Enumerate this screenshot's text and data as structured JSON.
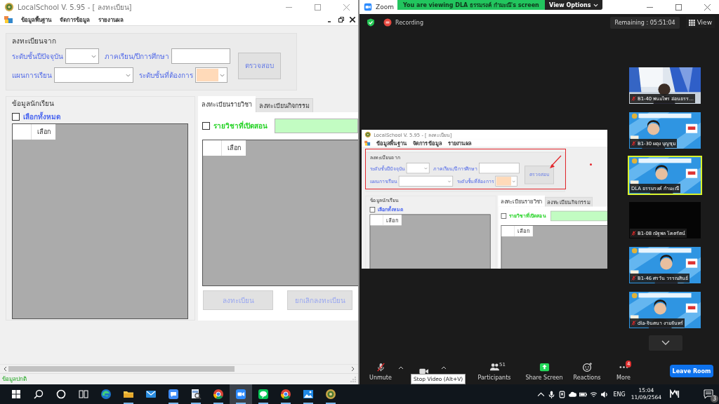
{
  "local_school": {
    "title": "LocalSchool V. 5.95 - [ ลงทะเบียน]",
    "menu": [
      "ข้อมูลพื้นฐาน",
      "จัดการข้อมูล",
      "รายงานผล"
    ],
    "register_from": {
      "title": "ลงทะเบียนจาก",
      "current_level_label": "ระดับชั้นปีปัจจุบัน",
      "term_label": "ภาคเรียน/ปีการศึกษา",
      "plan_label": "แผนการเรียน",
      "target_level_label": "ระดับชั้นที่ต้องการ",
      "check_button": "ตรวจสอบ"
    },
    "students": {
      "title": "ข้อมูลนักเรียน",
      "select_all": {
        "label": "เลือกทั้งหมด",
        "checked": false
      },
      "grid_header": "เลือก"
    },
    "tabs": [
      {
        "label": "ลงทะเบียนรายวิชา",
        "selected": true
      },
      {
        "label": "ลงทะเบียนกิจกรรม",
        "selected": false
      }
    ],
    "subjects": {
      "open_subjects": {
        "label": "รายวิชาที่เปิดสอน",
        "checked": false
      },
      "grid_header": "เลือก",
      "buttons": [
        {
          "label": "ลงทะเบียน",
          "disabled": true
        },
        {
          "label": "ยกเลิกลงทะเบียน",
          "disabled": true
        }
      ]
    },
    "status_bar": "ข้อมูลปกติ"
  },
  "zoom": {
    "title": "Zoom",
    "banner": "You are viewing DLA ธรรมรงค์ กำมะณี's screen",
    "view_options": "View Options",
    "recording": "Recording",
    "remaining": "Remaining : 05:51:04",
    "view": "View",
    "shared_screen": {
      "title": "LocalSchool V. 5.95 - [ ลงทะเบียน]",
      "menu": [
        "ข้อมูลพื้นฐาน",
        "จัดการข้อมูล",
        "รายงานผล"
      ],
      "register_from": {
        "title": "ลงทะเบียนจาก",
        "current_level_label": "ระดับชั้นปีปัจจุบัน",
        "term_label": "ภาคเรียน/ปีการศึกษา",
        "plan_label": "แผนการเรียน",
        "target_level_label": "ระดับชั้นที่ต้องการ",
        "check_button": "ตรวจสอบ"
      },
      "students": {
        "title": "ข้อมูลนักเรียน",
        "select_all": {
          "label": "เลือกทั้งหมด",
          "checked": false
        },
        "grid_header": "เลือก"
      },
      "tabs": [
        {
          "label": "ลงทะเบียนรายวิชา",
          "selected": true
        },
        {
          "label": "ลงทะเบียนกิจกรรม",
          "selected": false
        }
      ],
      "subjects": {
        "open_subjects": {
          "label": "รายวิชาที่เปิดสอน",
          "checked": false
        },
        "grid_header": "เลือก"
      }
    },
    "participants": [
      {
        "name": "B1-40 พนมไพร อ่อนธรร...",
        "muted": true,
        "video": true,
        "speaking": false
      },
      {
        "name": "B1-30 ผดุง บุญชุม",
        "muted": true,
        "video": true,
        "speaking": false
      },
      {
        "name": "DLA ธรรมรงค์ กำมะณี",
        "muted": false,
        "video": true,
        "speaking": true
      },
      {
        "name": "B1-08 ณัฐพล โคตรัตน์",
        "muted": true,
        "video": false,
        "speaking": false
      },
      {
        "name": "B1-46 ศรวัน วรรณสินธ์",
        "muted": true,
        "video": true,
        "speaking": false
      },
      {
        "name": "dla-จินตนา งามจันทร์",
        "muted": true,
        "video": true,
        "speaking": false
      }
    ],
    "toolbar": [
      {
        "kind": "mic",
        "label": "Unmute",
        "has_menu": true
      },
      {
        "kind": "video",
        "tooltip": "Stop Video (Alt+V)",
        "has_menu": true
      },
      {
        "kind": "participants",
        "label": "Participants",
        "count": "51",
        "has_menu": false
      },
      {
        "kind": "share",
        "label": "Share Screen",
        "has_menu": false
      },
      {
        "kind": "reactions",
        "label": "Reactions",
        "has_menu": false
      },
      {
        "kind": "more",
        "label": "More",
        "badge": "4",
        "has_menu": false
      }
    ],
    "leave_button": "Leave Room"
  },
  "taskbar": {
    "apps": [
      {
        "kind": "start",
        "active": false,
        "running": false
      },
      {
        "kind": "search",
        "active": false,
        "running": false
      },
      {
        "kind": "cortana",
        "active": false,
        "running": false
      },
      {
        "kind": "taskview",
        "active": false,
        "running": false
      },
      {
        "kind": "edge",
        "active": false,
        "running": false
      },
      {
        "kind": "folder",
        "active": false,
        "running": true
      },
      {
        "kind": "mail",
        "active": false,
        "running": false
      },
      {
        "kind": "chat",
        "active": false,
        "running": true
      },
      {
        "kind": "preview",
        "active": false,
        "running": true
      },
      {
        "kind": "chrome",
        "active": false,
        "running": true
      },
      {
        "kind": "zoomapp",
        "active": true,
        "running": true
      },
      {
        "kind": "line",
        "active": false,
        "running": true
      },
      {
        "kind": "chrome",
        "active": false,
        "running": true
      },
      {
        "kind": "photos",
        "active": false,
        "running": true
      },
      {
        "kind": "emblem",
        "active": false,
        "running": true
      }
    ],
    "language": "ENG",
    "time": "15:04",
    "date": "11/09/2564",
    "notifications": "3"
  }
}
